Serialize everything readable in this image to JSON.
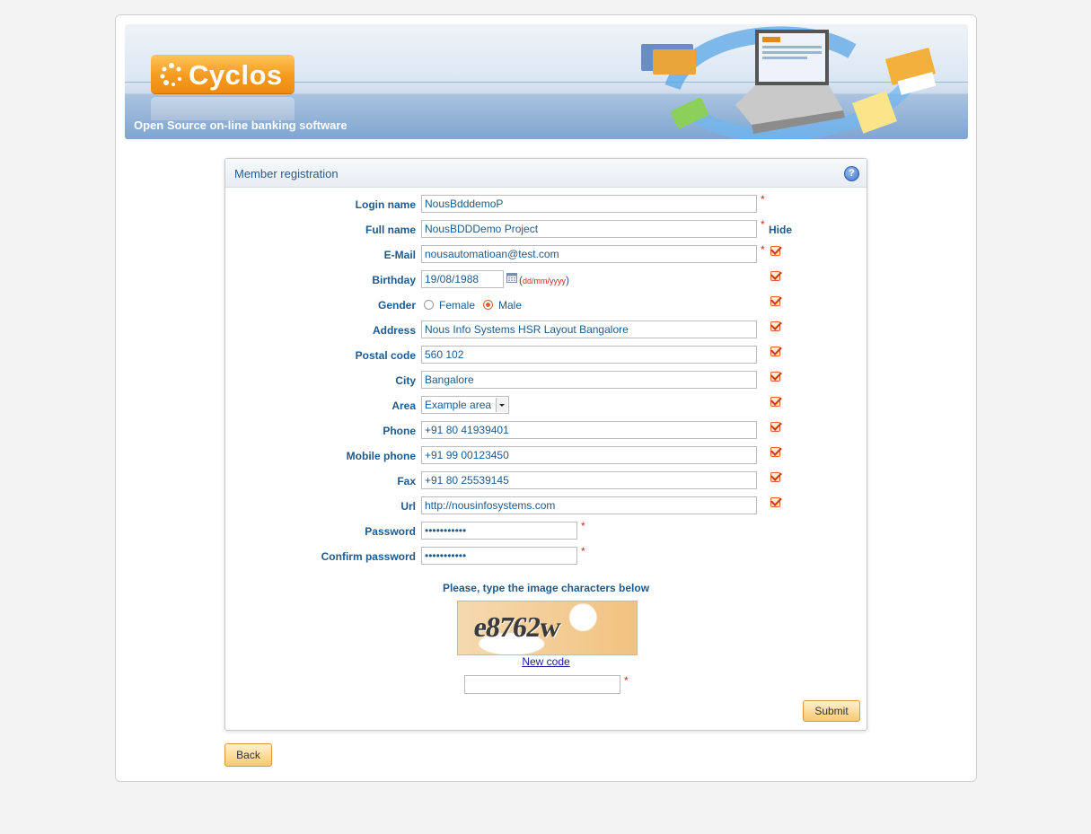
{
  "banner": {
    "logo_text": "Cyclos",
    "tagline": "Open Source on-line banking software"
  },
  "panel": {
    "title": "Member registration",
    "hide_header": "Hide"
  },
  "fields": {
    "login_name": {
      "label": "Login name",
      "value": "NousBdddemoP"
    },
    "full_name": {
      "label": "Full name",
      "value": "NousBDDDemo Project"
    },
    "email": {
      "label": "E-Mail",
      "value": "nousautomatioan@test.com"
    },
    "birthday": {
      "label": "Birthday",
      "value": "19/08/1988",
      "format_hint": "dd/mm/yyyy"
    },
    "gender": {
      "label": "Gender",
      "options": [
        "Female",
        "Male"
      ],
      "selected": "Male"
    },
    "address": {
      "label": "Address",
      "value": "Nous Info Systems HSR Layout Bangalore"
    },
    "postal_code": {
      "label": "Postal code",
      "value": "560 102"
    },
    "city": {
      "label": "City",
      "value": "Bangalore"
    },
    "area": {
      "label": "Area",
      "value": "Example area"
    },
    "phone": {
      "label": "Phone",
      "value": "+91 80 41939401"
    },
    "mobile_phone": {
      "label": "Mobile phone",
      "value": "+91 99 00123450"
    },
    "fax": {
      "label": "Fax",
      "value": "+91 80 25539145"
    },
    "url": {
      "label": "Url",
      "value": "http://nousinfosystems.com"
    },
    "password": {
      "label": "Password",
      "value": "•••••••••••"
    },
    "confirm_password": {
      "label": "Confirm password",
      "value": "•••••••••••"
    }
  },
  "captcha": {
    "instruction": "Please, type the image characters below",
    "image_text": "e8762w",
    "new_code_link": "New code",
    "input_value": ""
  },
  "buttons": {
    "submit": "Submit",
    "back": "Back"
  },
  "required_marker": "*"
}
